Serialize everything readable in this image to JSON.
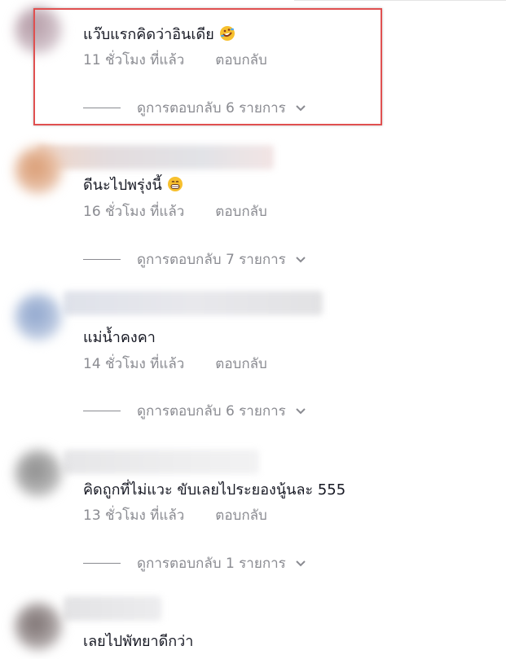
{
  "comments": [
    {
      "text": "แว๊บแรกคิดว่าอินเดีย",
      "emoji": "rofl-emoji",
      "time": "11 ชั่วโมง ที่แล้ว",
      "reply_label": "ตอบกลับ",
      "view_replies": "ดูการตอบกลับ 6 รายการ"
    },
    {
      "text": "ดีนะไปพรุ่งนี้",
      "emoji": "grin-emoji",
      "time": "16 ชั่วโมง ที่แล้ว",
      "reply_label": "ตอบกลับ",
      "view_replies": "ดูการตอบกลับ 7 รายการ"
    },
    {
      "text": "แม่น้ำคงคา",
      "time": "14 ชั่วโมง ที่แล้ว",
      "reply_label": "ตอบกลับ",
      "view_replies": "ดูการตอบกลับ 6 รายการ"
    },
    {
      "text": "คิดถูกที่ไม่แวะ ขับเลยไประยองนู้นละ 555",
      "time": "13 ชั่วโมง ที่แล้ว",
      "reply_label": "ตอบกลับ",
      "view_replies": "ดูการตอบกลับ 1 รายการ"
    },
    {
      "text": "เลยไปพัทยาดีกว่า"
    }
  ],
  "colors": {
    "highlight_border": "#e05050",
    "meta_text": "#8a8b91",
    "body_text": "#161823"
  }
}
